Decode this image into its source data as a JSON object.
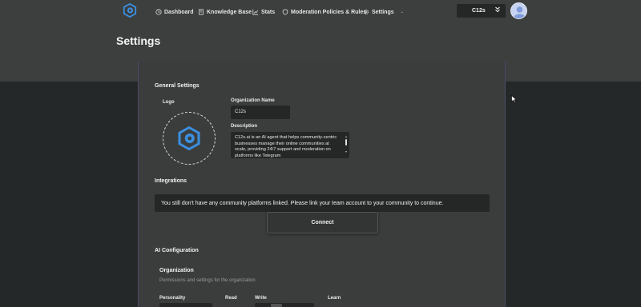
{
  "nav": {
    "items": [
      {
        "label": "Dashboard",
        "icon": "clock-icon"
      },
      {
        "label": "Knowledge Base",
        "icon": "book-icon"
      },
      {
        "label": "Stats",
        "icon": "chart-icon"
      },
      {
        "label": "Moderation Policies & Rules",
        "icon": "shield-icon"
      },
      {
        "label": "Settings",
        "icon": "gear-icon"
      }
    ],
    "org_selector": "C12s"
  },
  "page": {
    "title": "Settings"
  },
  "general": {
    "title": "General Settings",
    "logo_label": "Logo",
    "org_name_label": "Organization Name",
    "org_name_value": "C12s",
    "description_label": "Description",
    "description_value": "C12s.ai is an AI agent that helps community-centric businesses manage their online communities at scale, providing 24/7 support and moderation on platforms like Telegram"
  },
  "integrations": {
    "title": "Integrations",
    "notice": "You still don't have any community platforms linked. Please link your team account to your community to continue.",
    "connect_label": "Connect"
  },
  "ai_config": {
    "title": "AI Configuration",
    "org_title": "Organization",
    "org_subtitle": "Permissions and settings for the organization",
    "columns": {
      "personality": "Personality",
      "read": "Read",
      "write": "Write",
      "learn": "Learn"
    }
  },
  "colors": {
    "brand": "#3b8fe0",
    "page_bg": "#252828",
    "header_bg": "#3d3e3e",
    "card_bg": "#3b3d3d"
  }
}
